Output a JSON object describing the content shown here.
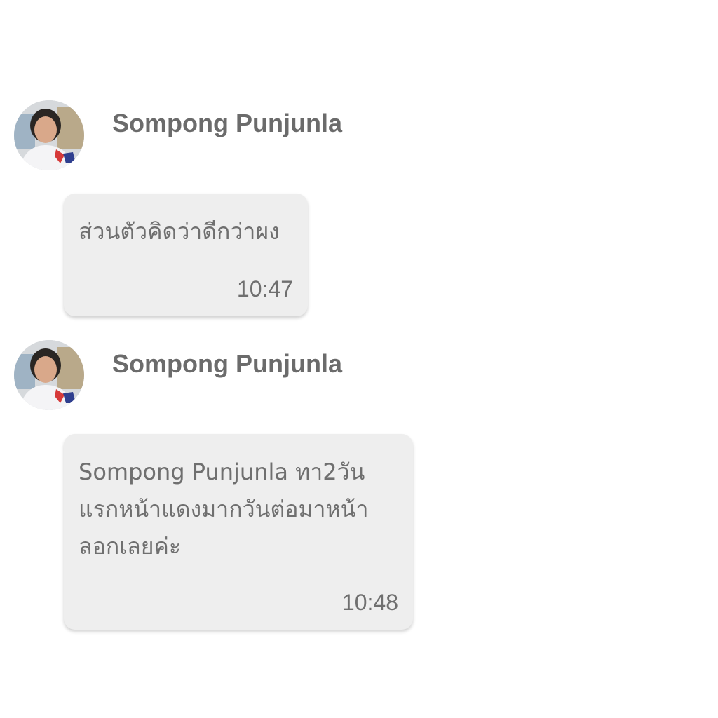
{
  "messages": [
    {
      "sender": "Sompong Punjunla",
      "text": "ส่วนตัวคิดว่าดีกว่าผง",
      "time": "10:47"
    },
    {
      "sender": "Sompong Punjunla",
      "text": "Sompong Punjunla ทา2วัน\nแรกหน้าแดงมากวันต่อมาหน้า\nลอกเลยค่ะ",
      "time": "10:48"
    }
  ]
}
